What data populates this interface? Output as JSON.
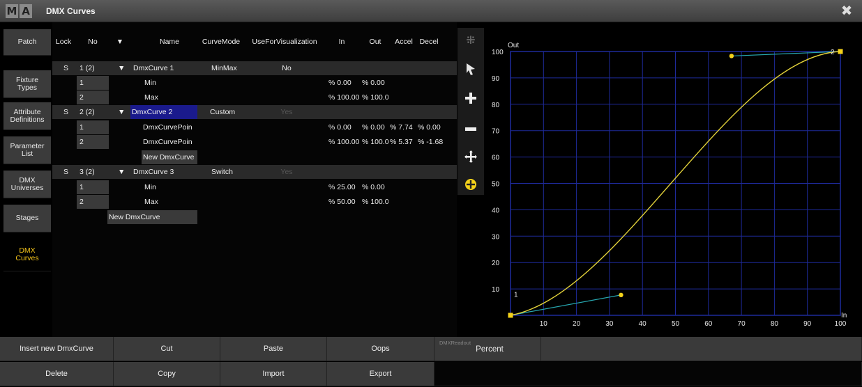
{
  "window": {
    "logo_m": "M",
    "logo_a": "A",
    "title": "DMX Curves"
  },
  "tabs": [
    {
      "label": "Patch"
    },
    {
      "label": "Fixture\nTypes"
    },
    {
      "label": "Attribute\nDefinitions"
    },
    {
      "label": "Parameter\nList"
    },
    {
      "label": "DMX\nUniverses"
    },
    {
      "label": "Stages"
    },
    {
      "label": "DMX\nCurves"
    }
  ],
  "table": {
    "headers": {
      "lock": "Lock",
      "no": "No",
      "expand": "▼",
      "name": "Name",
      "curvemode": "CurveMode",
      "usevis": "UseForVisualization",
      "in": "In",
      "out": "Out",
      "accel": "Accel",
      "decel": "Decel"
    },
    "rows": [
      {
        "lock": "S",
        "no": "1 (2)",
        "expand": "▼",
        "name": "DmxCurve 1",
        "mode": "MinMax",
        "vis": "No",
        "in": "",
        "out": "",
        "accel": "",
        "decel": ""
      },
      {
        "lock": "",
        "no": "1",
        "expand": "",
        "name": "Min",
        "mode": "",
        "vis": "",
        "in": "% 0.00",
        "out": "% 0.00",
        "accel": "",
        "decel": ""
      },
      {
        "lock": "",
        "no": "2",
        "expand": "",
        "name": "Max",
        "mode": "",
        "vis": "",
        "in": "% 100.00",
        "out": "% 100.0",
        "accel": "",
        "decel": ""
      },
      {
        "lock": "S",
        "no": "2 (2)",
        "expand": "▼",
        "name": "DmxCurve 2",
        "mode": "Custom",
        "vis": "Yes",
        "in": "",
        "out": "",
        "accel": "",
        "decel": ""
      },
      {
        "lock": "",
        "no": "1",
        "expand": "",
        "name": "DmxCurvePoin",
        "mode": "",
        "vis": "",
        "in": "% 0.00",
        "out": "% 0.00",
        "accel": "% 7.74",
        "decel": "% 0.00"
      },
      {
        "lock": "",
        "no": "2",
        "expand": "",
        "name": "DmxCurvePoin",
        "mode": "",
        "vis": "",
        "in": "% 100.00",
        "out": "% 100.0",
        "accel": "% 5.37",
        "decel": "% -1.68"
      },
      {
        "lock": "",
        "no": "",
        "expand": "",
        "name": "New DmxCurve",
        "mode": "",
        "vis": "",
        "in": "",
        "out": "",
        "accel": "",
        "decel": ""
      },
      {
        "lock": "S",
        "no": "3 (2)",
        "expand": "▼",
        "name": "DmxCurve 3",
        "mode": "Switch",
        "vis": "Yes",
        "in": "",
        "out": "",
        "accel": "",
        "decel": ""
      },
      {
        "lock": "",
        "no": "1",
        "expand": "",
        "name": "Min",
        "mode": "",
        "vis": "",
        "in": "% 25.00",
        "out": "% 0.00",
        "accel": "",
        "decel": ""
      },
      {
        "lock": "",
        "no": "2",
        "expand": "",
        "name": "Max",
        "mode": "",
        "vis": "",
        "in": "% 50.00",
        "out": "% 100.0",
        "accel": "",
        "decel": ""
      }
    ],
    "new_curve": "New DmxCurve"
  },
  "tools": [
    "grip-icon",
    "pointer-icon",
    "plus-icon",
    "minus-icon",
    "move-icon",
    "center-icon"
  ],
  "graph": {
    "y_label": "Out",
    "x_label": "In",
    "x_ticks": [
      "10",
      "20",
      "30",
      "40",
      "50",
      "60",
      "70",
      "80",
      "90",
      "100"
    ],
    "y_ticks": [
      "10",
      "20",
      "30",
      "40",
      "50",
      "60",
      "70",
      "80",
      "90",
      "100"
    ],
    "point_labels": [
      "1",
      "2"
    ],
    "curve_color": "#e3d23a",
    "grid_color": "#1e2a9a",
    "handle_color": "#27a7b0",
    "point_color": "#f4d21a"
  },
  "buttons": {
    "insert": "Insert new DmxCurve",
    "cut": "Cut",
    "paste": "Paste",
    "oops": "Oops",
    "delete": "Delete",
    "copy": "Copy",
    "import": "Import",
    "export": "Export"
  },
  "readout": {
    "label": "DMXReadout",
    "value": "Percent"
  }
}
